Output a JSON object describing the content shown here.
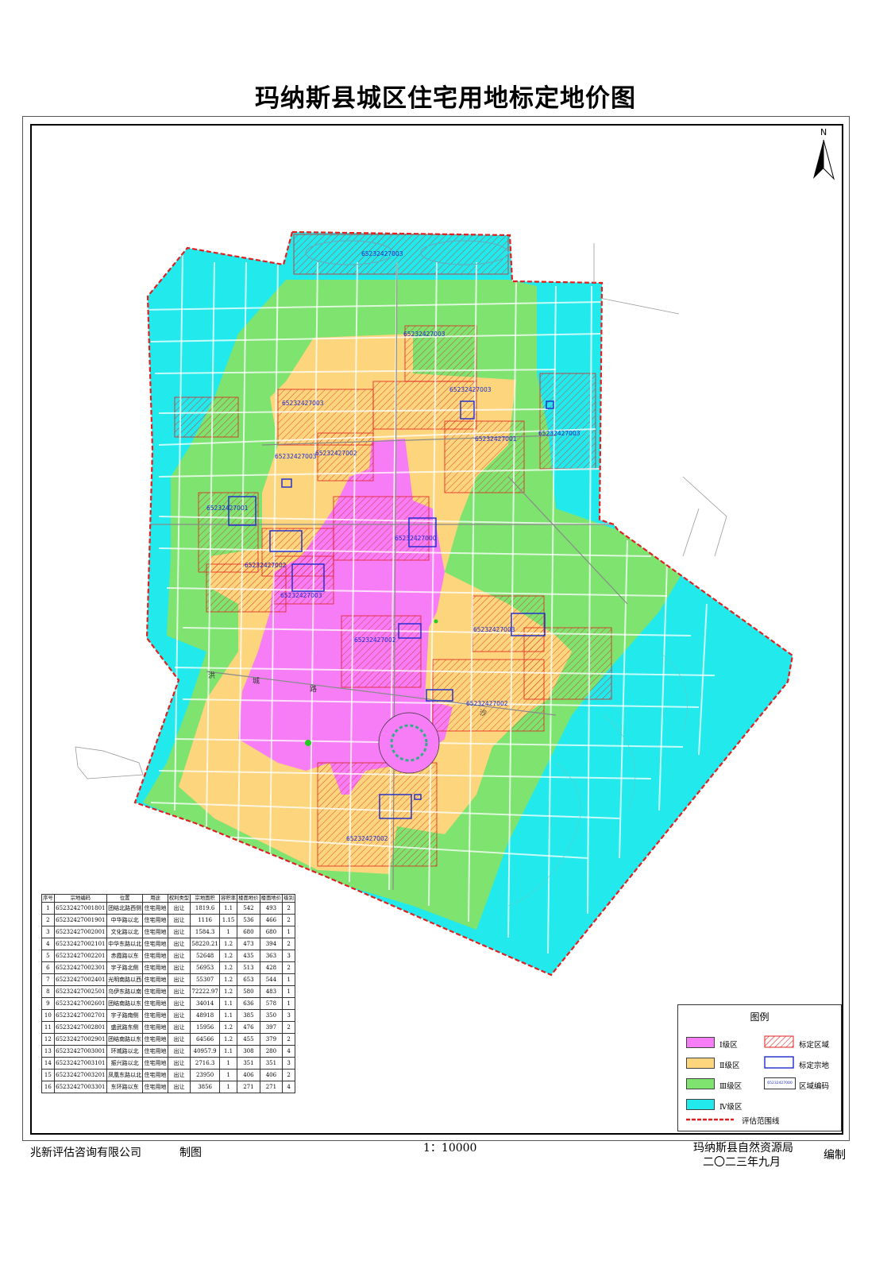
{
  "title": "玛纳斯县城区住宅用地标定地价图",
  "north_label": "N",
  "colors": {
    "grade1": "#f77df7",
    "grade2": "#fcd57c",
    "grade3": "#7ee36f",
    "grade4": "#22eaec",
    "boundary": "#e02020",
    "parcel": "#1a2ad0"
  },
  "region_codes": [
    "65232427003",
    "65232427003",
    "65232427003",
    "65232427003",
    "65232427001",
    "65232427003",
    "65232427003",
    "65232427002",
    "65232427001",
    "65232427000",
    "65232427002",
    "65232427003",
    "65232427002",
    "65232427003",
    "65232427002",
    "65232427002",
    "65232427002"
  ],
  "street_text": [
    "洪",
    "城",
    "路",
    "沙"
  ],
  "table": {
    "headers": [
      "序号",
      "宗地编码",
      "位置",
      "用途",
      "权利类型",
      "宗地面积",
      "容积率",
      "楼面地价",
      "楼面地价",
      "级别"
    ],
    "rows": [
      [
        "1",
        "65232427001801",
        "团结北路西侧",
        "住宅用地",
        "出让",
        "1819.6",
        "1.1",
        "542",
        "493",
        "2"
      ],
      [
        "2",
        "65232427001901",
        "中华路以北",
        "住宅用地",
        "出让",
        "1116",
        "1.15",
        "536",
        "466",
        "2"
      ],
      [
        "3",
        "65232427002001",
        "文化路以北",
        "住宅用地",
        "出让",
        "1584.3",
        "1",
        "680",
        "680",
        "1"
      ],
      [
        "4",
        "65232427002101",
        "中华东路以北",
        "住宅用地",
        "出让",
        "58220.21",
        "1.2",
        "473",
        "394",
        "2"
      ],
      [
        "5",
        "65232427002201",
        "赤霞路以东",
        "住宅用地",
        "出让",
        "52648",
        "1.2",
        "435",
        "363",
        "3"
      ],
      [
        "6",
        "65232427002301",
        "宇子路北侧",
        "住宅用地",
        "出让",
        "56953",
        "1.2",
        "513",
        "428",
        "2"
      ],
      [
        "7",
        "65232427002401",
        "光明南路以西",
        "住宅用地",
        "出让",
        "55307",
        "1.2",
        "653",
        "544",
        "1"
      ],
      [
        "8",
        "65232427002501",
        "乌伊东路以南",
        "住宅用地",
        "出让",
        "72222.97",
        "1.2",
        "580",
        "483",
        "1"
      ],
      [
        "9",
        "65232427002601",
        "团结南路以东",
        "住宅用地",
        "出让",
        "34014",
        "1.1",
        "636",
        "578",
        "1"
      ],
      [
        "10",
        "65232427002701",
        "宇子路南侧",
        "住宅用地",
        "出让",
        "48918",
        "1.1",
        "385",
        "350",
        "3"
      ],
      [
        "11",
        "65232427002801",
        "盛武路东侧",
        "住宅用地",
        "出让",
        "15956",
        "1.2",
        "476",
        "397",
        "2"
      ],
      [
        "12",
        "65232427002901",
        "团结南路以东",
        "住宅用地",
        "出让",
        "64566",
        "1.2",
        "455",
        "379",
        "2"
      ],
      [
        "13",
        "65232427003001",
        "环城路以北",
        "住宅用地",
        "出让",
        "40957.9",
        "1.1",
        "308",
        "280",
        "4"
      ],
      [
        "14",
        "65232427003101",
        "振兴路以北",
        "住宅用地",
        "出让",
        "2716.3",
        "1",
        "351",
        "351",
        "3"
      ],
      [
        "15",
        "65232427003201",
        "凤凰东路以北",
        "住宅用地",
        "出让",
        "23950",
        "1",
        "406",
        "406",
        "2"
      ],
      [
        "16",
        "65232427003301",
        "东环路以东",
        "住宅用地",
        "出让",
        "3856",
        "1",
        "271",
        "271",
        "4"
      ]
    ]
  },
  "legend": {
    "title": "图例",
    "grade1": "Ⅰ级区",
    "grade2": "Ⅱ级区",
    "grade3": "Ⅲ级区",
    "grade4": "Ⅳ级区",
    "standard_zone": "标定区域",
    "standard_parcel": "标定宗地",
    "zone_code": "区域编码",
    "zone_code_sample": "65232427000",
    "boundary": "评估范围线"
  },
  "footer": {
    "company": "兆新评估咨询有限公司",
    "made": "制图",
    "scale": "1：10000",
    "bureau": "玛纳斯县自然资源局",
    "date": "二〇二三年九月",
    "compiled": "编制"
  }
}
